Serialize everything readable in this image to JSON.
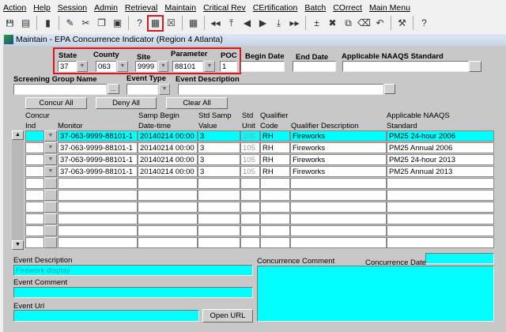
{
  "menu": [
    "Action",
    "Help",
    "Session",
    "Admin",
    "Retrieval",
    "Maintain",
    "Critical Rev",
    "CErtification",
    "Batch",
    "COrrect",
    "Main Menu"
  ],
  "toolbar": [
    "save-icon",
    "print-icon",
    "exit-icon",
    "edit-icon",
    "cut-icon",
    "copy-icon",
    "paste-icon",
    "query-icon",
    "execute-query-icon",
    "cancel-query-icon",
    "calculator-icon",
    "first-record-icon",
    "first-icon",
    "previous-icon",
    "next-icon",
    "down-icon",
    "last-record-icon",
    "insert-record-icon",
    "delete-record-icon",
    "duplicate-icon",
    "clear-icon",
    "undo-icon",
    "tools-icon",
    "help-icon"
  ],
  "window_title": "Maintain - EPA Concurrence Indicator (Region 4 Atlanta)",
  "filters": {
    "state_label": "State",
    "state": "37",
    "county_label": "County",
    "county": "063",
    "site_label": "Site",
    "site": "9999",
    "parameter_label": "Parameter",
    "parameter": "88101",
    "poc_label": "POC",
    "poc": "1",
    "begin_label": "Begin Date",
    "begin": "",
    "end_label": "End Date",
    "end": "",
    "naaqs_label": "Applicable NAAQS Standard",
    "naaqs": "",
    "screening_label": "Screening Group Name",
    "event_type_label": "Event Type",
    "event_desc_label": "Event Description"
  },
  "buttons": {
    "concur_all": "Concur All",
    "deny_all": "Deny All",
    "clear_all": "Clear All",
    "open_url": "Open URL"
  },
  "columns": {
    "concur1": "Concur",
    "concur2": "Ind",
    "monitor": "Monitor",
    "samp1": "Samp Begin",
    "samp2": "Date-time",
    "val1": "Std Samp",
    "val2": "Value",
    "unit1": "Std",
    "unit2": "Unit",
    "qc1": "Qualifier",
    "qc2": "Code",
    "qdesc": "Qualifier Description",
    "std1": "Applicable NAAQS",
    "std2": "Standard"
  },
  "rows": [
    {
      "concur": "",
      "monitor": "37-063-9999-88101-1",
      "date": "20140214 00:00",
      "value": "3",
      "unit": "105",
      "code": "RH",
      "desc": "Fireworks",
      "std": "PM25 24-hour 2006"
    },
    {
      "concur": "",
      "monitor": "37-063-9999-88101-1",
      "date": "20140214 00:00",
      "value": "3",
      "unit": "105",
      "code": "RH",
      "desc": "Fireworks",
      "std": "PM25 Annual 2006"
    },
    {
      "concur": "",
      "monitor": "37-063-9999-88101-1",
      "date": "20140214 00:00",
      "value": "3",
      "unit": "105",
      "code": "RH",
      "desc": "Fireworks",
      "std": "PM25 24-hour 2013"
    },
    {
      "concur": "",
      "monitor": "37-063-9999-88101-1",
      "date": "20140214 00:00",
      "value": "3",
      "unit": "105",
      "code": "RH",
      "desc": "Fireworks",
      "std": "PM25 Annual 2013"
    }
  ],
  "detail": {
    "event_desc_label": "Event Description",
    "event_desc": "Firework display",
    "event_comment_label": "Event Comment",
    "event_comment": "",
    "event_url_label": "Event Url",
    "event_url": "",
    "conc_comment_label": "Concurrence Comment",
    "conc_comment": "",
    "conc_date_label": "Concurrence Date",
    "conc_date": ""
  }
}
